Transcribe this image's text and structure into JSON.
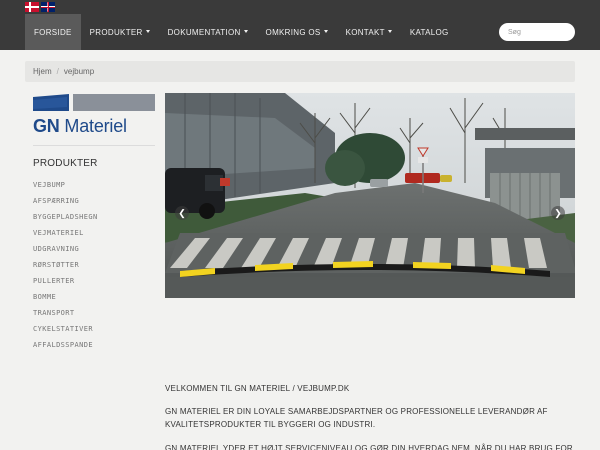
{
  "nav": {
    "items": [
      {
        "label": "FORSIDE",
        "active": true,
        "dropdown": false
      },
      {
        "label": "PRODUKTER",
        "active": false,
        "dropdown": true
      },
      {
        "label": "DOKUMENTATION",
        "active": false,
        "dropdown": true
      },
      {
        "label": "OMKRING OS",
        "active": false,
        "dropdown": true
      },
      {
        "label": "KONTAKT",
        "active": false,
        "dropdown": true
      },
      {
        "label": "KATALOG",
        "active": false,
        "dropdown": false
      }
    ],
    "search_placeholder": "Søg",
    "languages": [
      "danish-flag-icon",
      "uk-flag-icon"
    ]
  },
  "breadcrumb": {
    "home": "Hjem",
    "current": "vejbump"
  },
  "logo": {
    "brand": "GN",
    "name": "Materiel"
  },
  "sidebar": {
    "title": "PRODUKTER",
    "items": [
      "VEJBUMP",
      "AFSPÆRRING",
      "BYGGEPLADSHEGN",
      "VEJMATERIEL",
      "UDGRAVNING",
      "RØRSTØTTER",
      "PULLERTER",
      "BOMME",
      "TRANSPORT",
      "CYKELSTATIVER",
      "AFFALDSSPANDE"
    ]
  },
  "carousel": {
    "prev_icon": "chevron-left-icon",
    "next_icon": "chevron-right-icon"
  },
  "content": {
    "welcome": "VELKOMMEN TIL GN MATERIEL / VEJBUMP.DK",
    "para1": "GN MATERIEL ER DIN LOYALE SAMARBEJDSPARTNER OG PROFESSIONELLE LEVERANDØR AF KVALITETSPRODUKTER TIL BYGGERI OG INDUSTRI.",
    "para2": "GN MATERIEL YDER ET HØJT SERVICENIVEAU OG GØR DIN HVERDAG NEM, NÅR DU HAR BRUG FOR INFORMATION"
  },
  "colors": {
    "topbar": "#3a3a3a",
    "nav_active": "#5a5a5a",
    "brand_blue": "#1f4a8a",
    "page_bg": "#f2f2f0"
  }
}
